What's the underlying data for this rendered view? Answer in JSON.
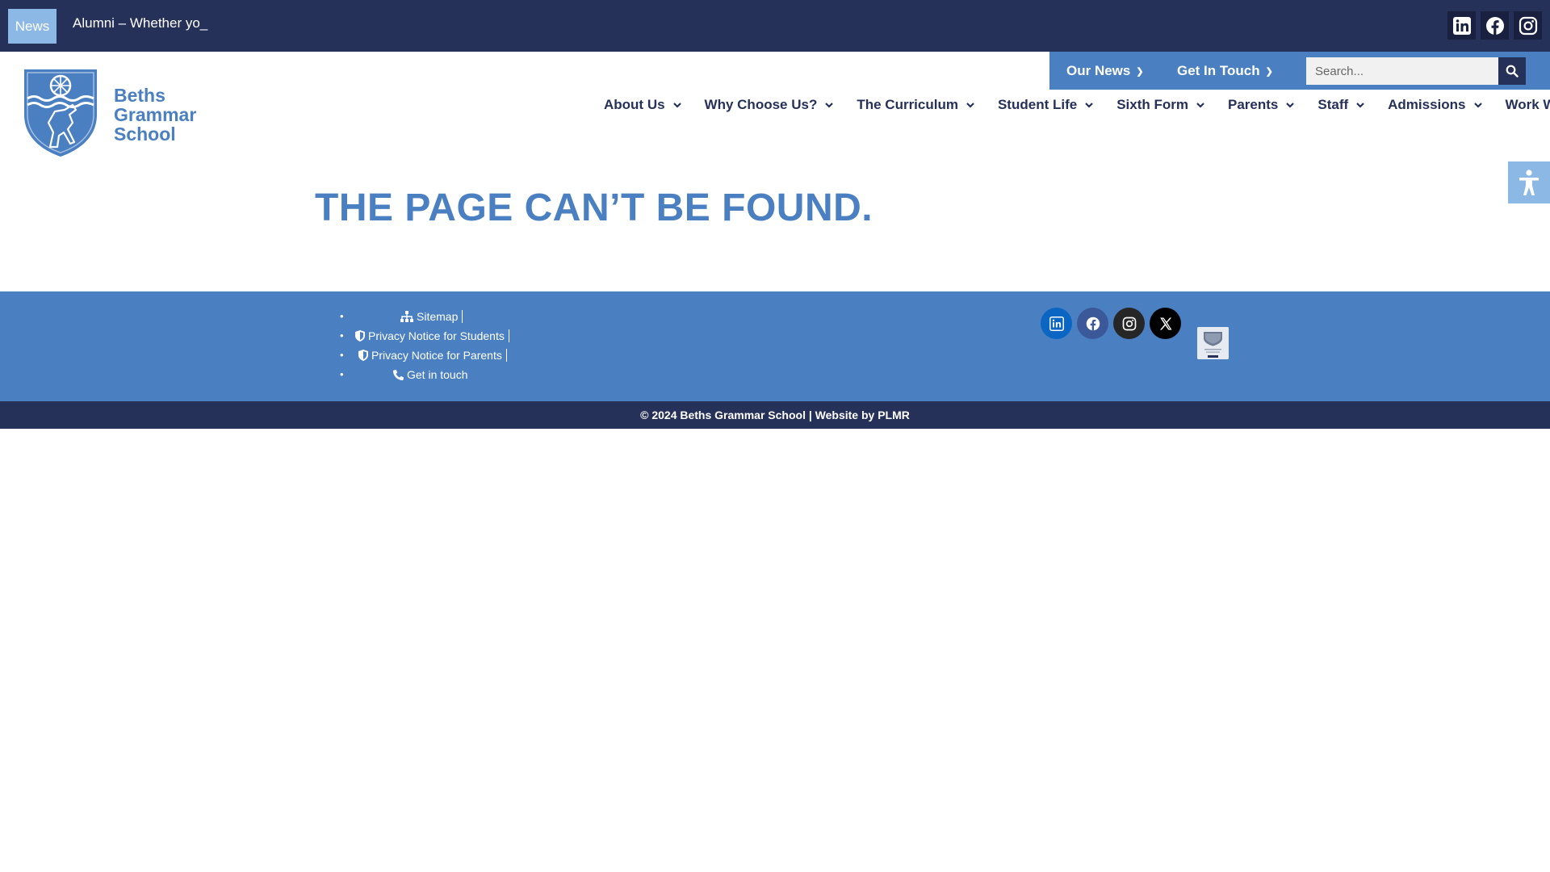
{
  "colors": {
    "navy": "#263159",
    "brand_blue": "#4a7fc1",
    "light_blue": "#8cb8e6",
    "white": "#ffffff"
  },
  "topbar": {
    "news_label": "News",
    "ticker_text": "Alumni – Whether yo_",
    "social_icons": [
      "linkedin-icon",
      "facebook-icon",
      "instagram-icon"
    ]
  },
  "header": {
    "school_name": [
      "Beths",
      "Grammar",
      "School"
    ],
    "utility_nav": [
      {
        "label": "Our News",
        "icon": "chevron-down-icon"
      },
      {
        "label": "Get In Touch",
        "icon": "chevron-down-icon"
      }
    ],
    "search": {
      "placeholder": "Search...",
      "value": "",
      "icon": "search-icon"
    },
    "main_nav": [
      {
        "label": "About Us",
        "has_dropdown": true
      },
      {
        "label": "Why Choose Us?",
        "has_dropdown": true
      },
      {
        "label": "The Curriculum",
        "has_dropdown": true
      },
      {
        "label": "Student Life",
        "has_dropdown": true
      },
      {
        "label": "Sixth Form",
        "has_dropdown": true
      },
      {
        "label": "Parents",
        "has_dropdown": true
      },
      {
        "label": "Staff",
        "has_dropdown": true
      },
      {
        "label": "Admissions",
        "has_dropdown": true
      },
      {
        "label": "Work With Us",
        "has_dropdown": false
      }
    ],
    "accessibility_icon": "accessibility-icon"
  },
  "main": {
    "heading": "THE PAGE CAN’T BE FOUND."
  },
  "footer": {
    "links": [
      {
        "label": "Sitemap",
        "icon": "sitemap-icon"
      },
      {
        "label": "Privacy Notice for Students",
        "icon": "shield-icon"
      },
      {
        "label": "Privacy Notice for Parents",
        "icon": "shield-icon"
      },
      {
        "label": "Get in touch",
        "icon": "phone-icon"
      }
    ],
    "social_icons": [
      "linkedin-icon",
      "facebook-icon",
      "instagram-icon",
      "x-icon"
    ],
    "badge_icon": "award-badge-icon",
    "copyright": "© 2024 Beths Grammar School | Website by PLMR"
  }
}
